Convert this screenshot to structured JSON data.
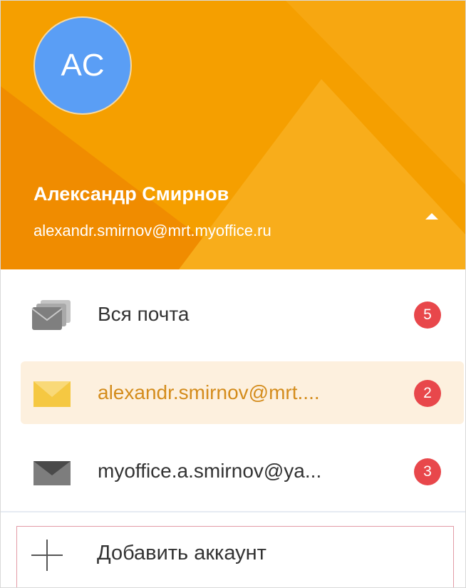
{
  "colors": {
    "header_bg": "#f59f00",
    "avatar_bg": "#5a9ef5",
    "badge_bg": "#e8474b",
    "selected_bg": "#fdf0de",
    "selected_text": "#d48c1c"
  },
  "header": {
    "avatar_initials": "AC",
    "user_name": "Александр Смирнов",
    "user_email": "alexandr.smirnov@mrt.myoffice.ru",
    "toggle_icon": "caret-up-icon"
  },
  "accounts": [
    {
      "label": "Вся почта",
      "count": "5",
      "icon": "all-mail-icon",
      "selected": false
    },
    {
      "label": "alexandr.smirnov@mrt....",
      "count": "2",
      "icon": "mail-icon",
      "selected": true
    },
    {
      "label": "myoffice.a.smirnov@ya...",
      "count": "3",
      "icon": "mail-icon",
      "selected": false
    }
  ],
  "add_account": {
    "label": "Добавить аккаунт",
    "icon": "plus-icon"
  }
}
